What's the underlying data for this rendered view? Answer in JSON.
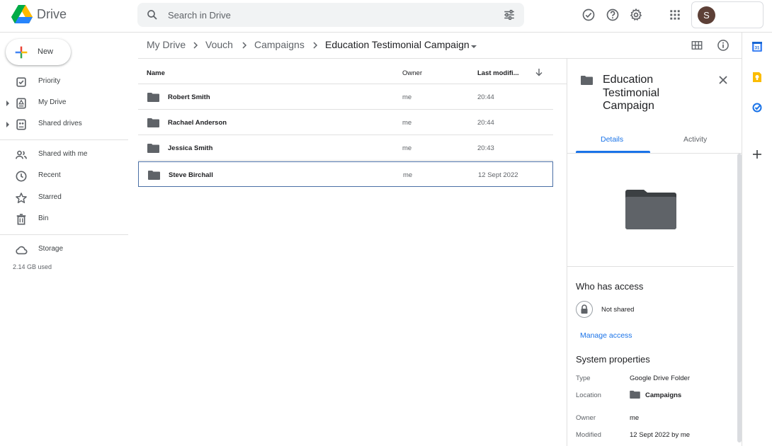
{
  "app": {
    "name": "Drive"
  },
  "search": {
    "placeholder": "Search in Drive"
  },
  "account": {
    "initial": "S",
    "avatar_color": "#5d4037"
  },
  "new_button": {
    "label": "New"
  },
  "sidebar": {
    "items": [
      {
        "label": "Priority",
        "icon": "priority-icon"
      },
      {
        "label": "My Drive",
        "icon": "my-drive-icon"
      },
      {
        "label": "Shared drives",
        "icon": "shared-drives-icon"
      },
      {
        "label": "Shared with me",
        "icon": "shared-with-me-icon"
      },
      {
        "label": "Recent",
        "icon": "clock-icon"
      },
      {
        "label": "Starred",
        "icon": "star-icon"
      },
      {
        "label": "Bin",
        "icon": "bin-icon"
      },
      {
        "label": "Storage",
        "icon": "cloud-icon"
      }
    ],
    "storage_used": "2.14 GB used"
  },
  "breadcrumb": [
    "My Drive",
    "Vouch",
    "Campaigns",
    "Education Testimonial Campaign"
  ],
  "list": {
    "columns": {
      "name": "Name",
      "owner": "Owner",
      "modified": "Last modifi..."
    },
    "rows": [
      {
        "name": "Robert Smith",
        "owner": "me",
        "modified": "20:44"
      },
      {
        "name": "Rachael Anderson",
        "owner": "me",
        "modified": "20:44"
      },
      {
        "name": "Jessica Smith",
        "owner": "me",
        "modified": "20:43"
      },
      {
        "name": "Steve Birchall",
        "owner": "me",
        "modified": "12 Sept 2022"
      }
    ]
  },
  "details": {
    "title": "Education Testimonial Campaign",
    "tabs": [
      "Details",
      "Activity"
    ],
    "who_has_access": "Who has access",
    "sharing_status": "Not shared",
    "manage_access": "Manage access",
    "system_properties": "System properties",
    "properties": {
      "type_label": "Type",
      "type_value": "Google Drive Folder",
      "location_label": "Location",
      "location_value": "Campaigns",
      "owner_label": "Owner",
      "owner_value": "me",
      "modified_label": "Modified",
      "modified_value": "12 Sept 2022 by me"
    }
  },
  "colors": {
    "accent": "#1a73e8",
    "folder": "#5f6368"
  }
}
